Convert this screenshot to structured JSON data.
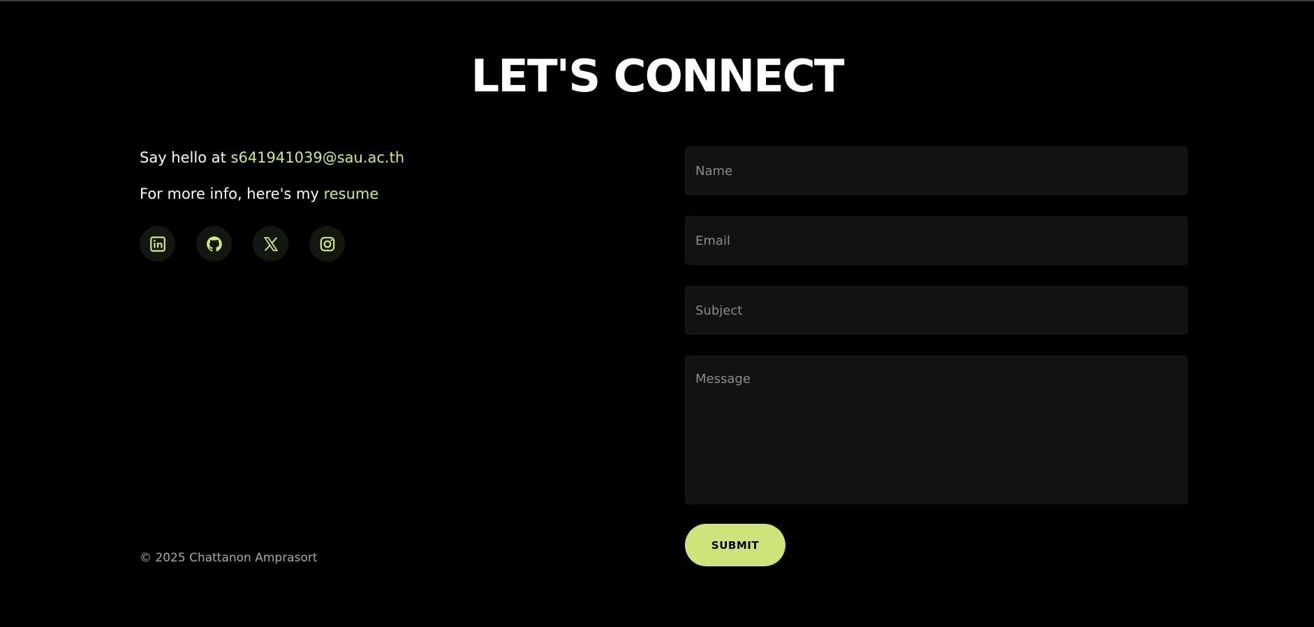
{
  "heading": "LET'S CONNECT",
  "contact": {
    "hello_prefix": "Say hello at ",
    "email": "s641941039@sau.ac.th",
    "info_prefix": "For more info, here's my ",
    "resume_label": "resume"
  },
  "socials": [
    {
      "name": "linkedin",
      "icon": "linkedin-icon"
    },
    {
      "name": "github",
      "icon": "github-icon"
    },
    {
      "name": "x",
      "icon": "x-icon"
    },
    {
      "name": "instagram",
      "icon": "instagram-icon"
    }
  ],
  "copyright": "© 2025 Chattanon Amprasort",
  "form": {
    "name_placeholder": "Name",
    "email_placeholder": "Email",
    "subject_placeholder": "Subject",
    "message_placeholder": "Message",
    "submit_label": "SUBMIT"
  },
  "colors": {
    "accent": "#d4ea7c",
    "button": "#cfe37a",
    "background": "#000000",
    "field_background": "#121212"
  }
}
